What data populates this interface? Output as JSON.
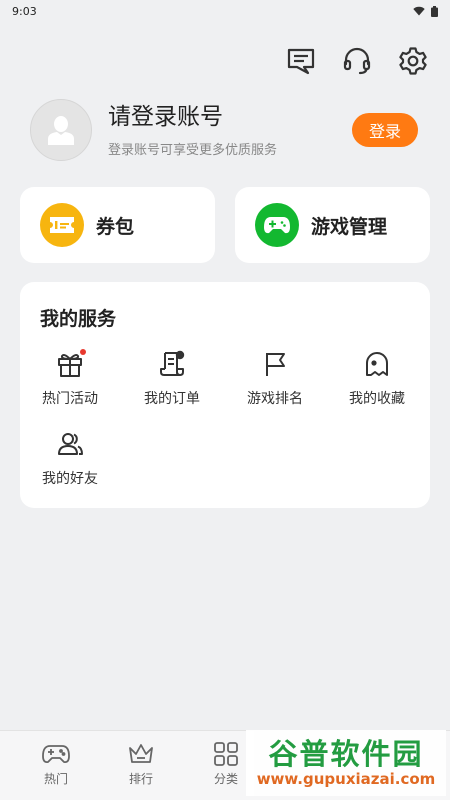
{
  "status_bar": {
    "time": "9:03"
  },
  "header": {
    "icons": [
      "message-icon",
      "headset-icon",
      "gear-icon"
    ]
  },
  "profile": {
    "title": "请登录账号",
    "subtitle": "登录账号可享受更多优质服务",
    "login_label": "登录"
  },
  "quick_cards": [
    {
      "label": "券包",
      "icon": "coupon-icon",
      "color": "#f7b50f"
    },
    {
      "label": "游戏管理",
      "icon": "gamepad-icon",
      "color": "#13b830"
    }
  ],
  "services": {
    "title": "我的服务",
    "items": [
      {
        "label": "热门活动",
        "icon": "gift-icon",
        "badge": true
      },
      {
        "label": "我的订单",
        "icon": "order-icon"
      },
      {
        "label": "游戏排名",
        "icon": "flag-icon"
      },
      {
        "label": "我的收藏",
        "icon": "ghost-icon"
      },
      {
        "label": "我的好友",
        "icon": "friends-icon"
      }
    ]
  },
  "tabbar": {
    "items": [
      {
        "label": "热门",
        "icon": "gamepad-icon"
      },
      {
        "label": "排行",
        "icon": "crown-icon"
      },
      {
        "label": "分类",
        "icon": "grid-icon"
      }
    ]
  },
  "watermark": {
    "title": "谷普软件园",
    "url": "www.gupuxiazai.com"
  },
  "colors": {
    "accent": "#ff7a12",
    "background": "#eff0f2",
    "badge": "#e8392f"
  }
}
